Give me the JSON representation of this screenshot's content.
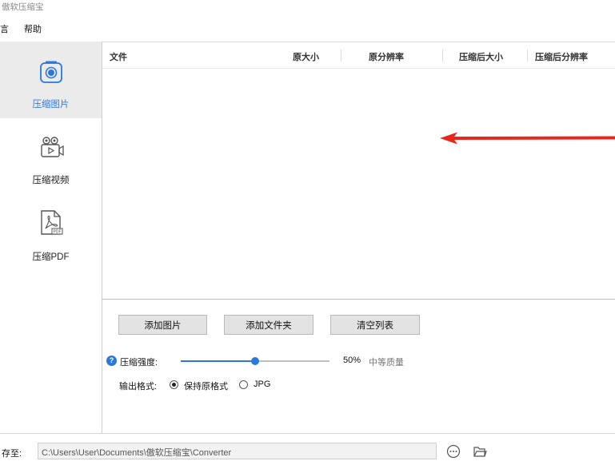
{
  "window": {
    "title": "傲软压缩宝"
  },
  "menu": {
    "items": [
      "言",
      "帮助"
    ]
  },
  "sidebar": {
    "items": [
      {
        "label": "压缩图片",
        "icon": "image-compress-icon",
        "active": true
      },
      {
        "label": "压缩视频",
        "icon": "video-compress-icon",
        "active": false
      },
      {
        "label": "压缩PDF",
        "icon": "pdf-compress-icon",
        "active": false
      }
    ]
  },
  "table": {
    "columns": [
      "文件",
      "原大小",
      "原分辨率",
      "压缩后大小",
      "压缩后分辨率"
    ],
    "rows": []
  },
  "actions": {
    "add_images": "添加图片",
    "add_folder": "添加文件夹",
    "clear_list": "清空列表"
  },
  "compression": {
    "label": "压缩强度:",
    "value": 50,
    "value_text": "50%",
    "quality_text": "中等质量"
  },
  "output_format": {
    "label": "输出格式:",
    "options": [
      "保持原格式",
      "JPG"
    ],
    "selected": "保持原格式"
  },
  "save": {
    "label": "存至:",
    "path": "C:\\Users\\User\\Documents\\傲软压缩宝\\Converter"
  },
  "colors": {
    "accent": "#2a78d9",
    "arrow": "#e8261c",
    "active_bg": "#ebebeb"
  }
}
